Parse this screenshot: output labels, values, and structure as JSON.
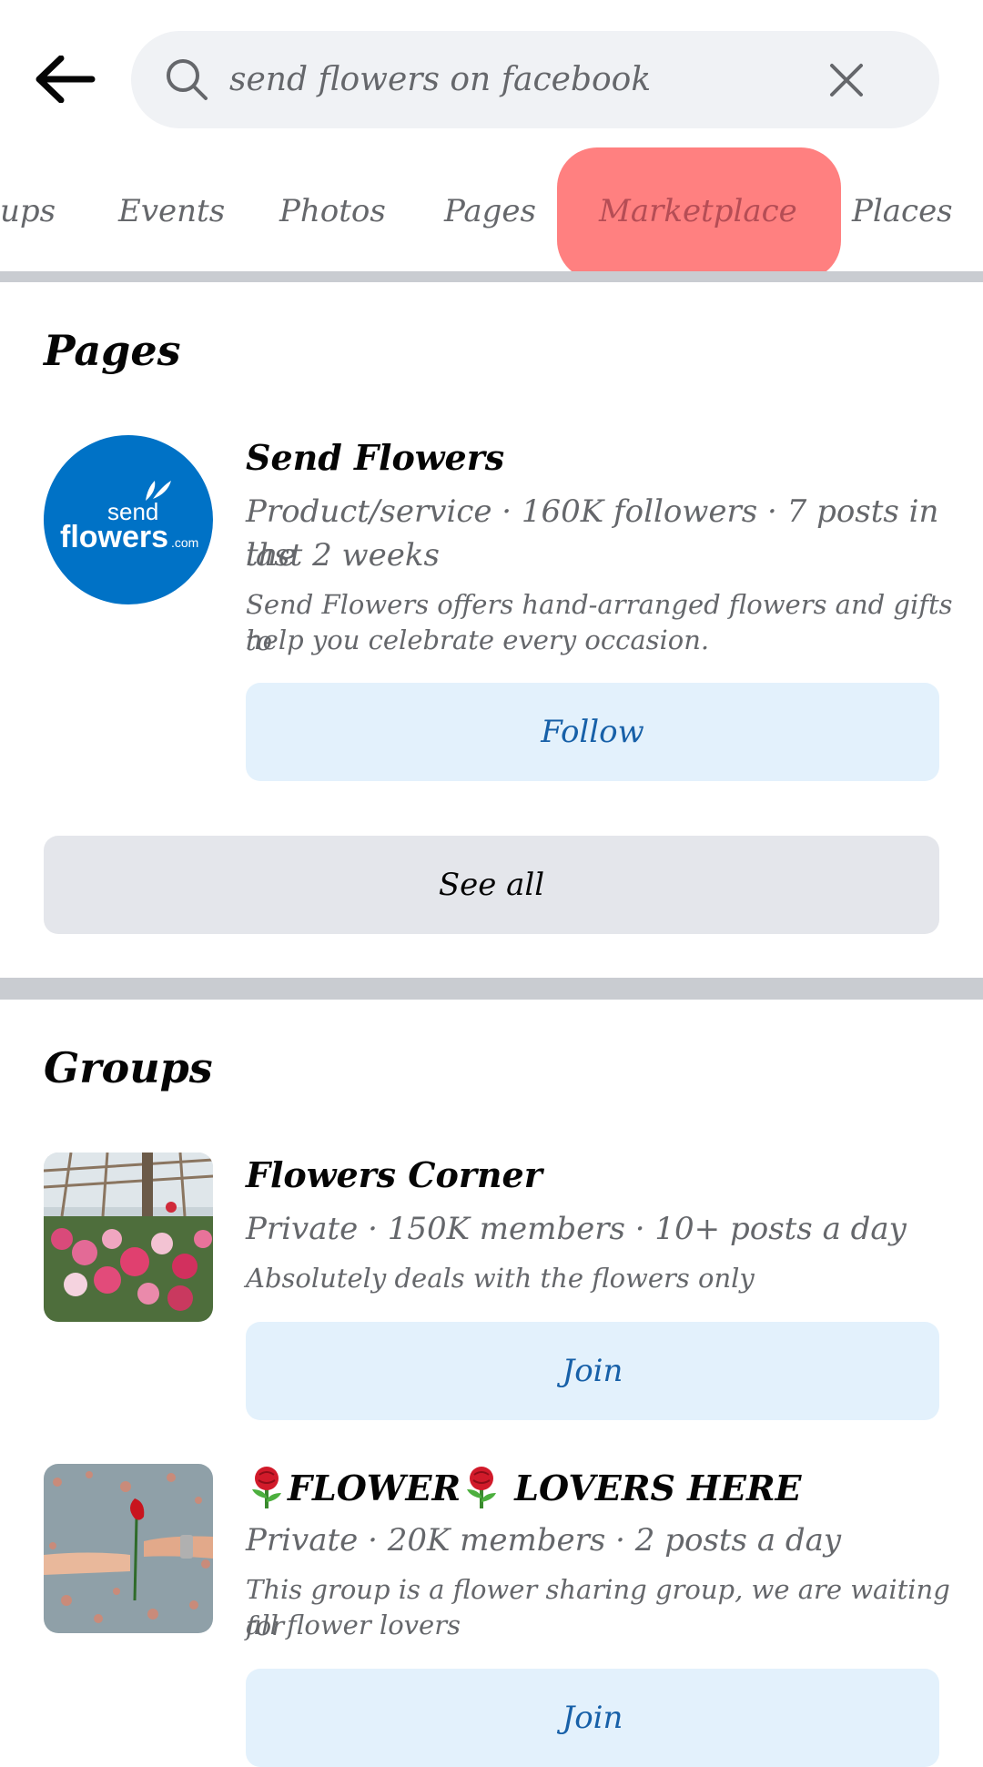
{
  "search": {
    "query": "send flowers on facebook"
  },
  "tabs": [
    {
      "label": "ups"
    },
    {
      "label": "Events"
    },
    {
      "label": "Photos"
    },
    {
      "label": "Pages"
    },
    {
      "label": "Marketplace",
      "highlighted": true
    },
    {
      "label": "Places"
    }
  ],
  "pages_section": {
    "title": "Pages",
    "items": [
      {
        "name": "Send Flowers",
        "logo_text_top": "send",
        "logo_text_main": "flowers",
        "logo_text_suffix": ".com",
        "meta_line1": "Product/service · 160K followers · 7 posts in the",
        "meta_line2": "last 2 weeks",
        "description_line1": "Send Flowers offers hand-arranged flowers and gifts to",
        "description_line2": "help you celebrate every occasion.",
        "action_label": "Follow"
      }
    ],
    "see_all_label": "See all"
  },
  "groups_section": {
    "title": "Groups",
    "items": [
      {
        "name": "Flowers Corner",
        "meta": "Private · 150K members · 10+ posts a day",
        "description": "Absolutely deals with the flowers only",
        "action_label": "Join"
      },
      {
        "name_part1": "FLOWER",
        "name_part2": " LOVERS HERE",
        "meta": "Private · 20K members · 2 posts a day",
        "description_line1": "This group is a flower sharing group, we are waiting for",
        "description_line2": "all flower lovers",
        "action_label": "Join"
      }
    ]
  },
  "colors": {
    "highlight": "#ff8080",
    "follow_bg": "#e3f1fc",
    "follow_text": "#1760a8",
    "logo_blue": "#0072c6"
  }
}
